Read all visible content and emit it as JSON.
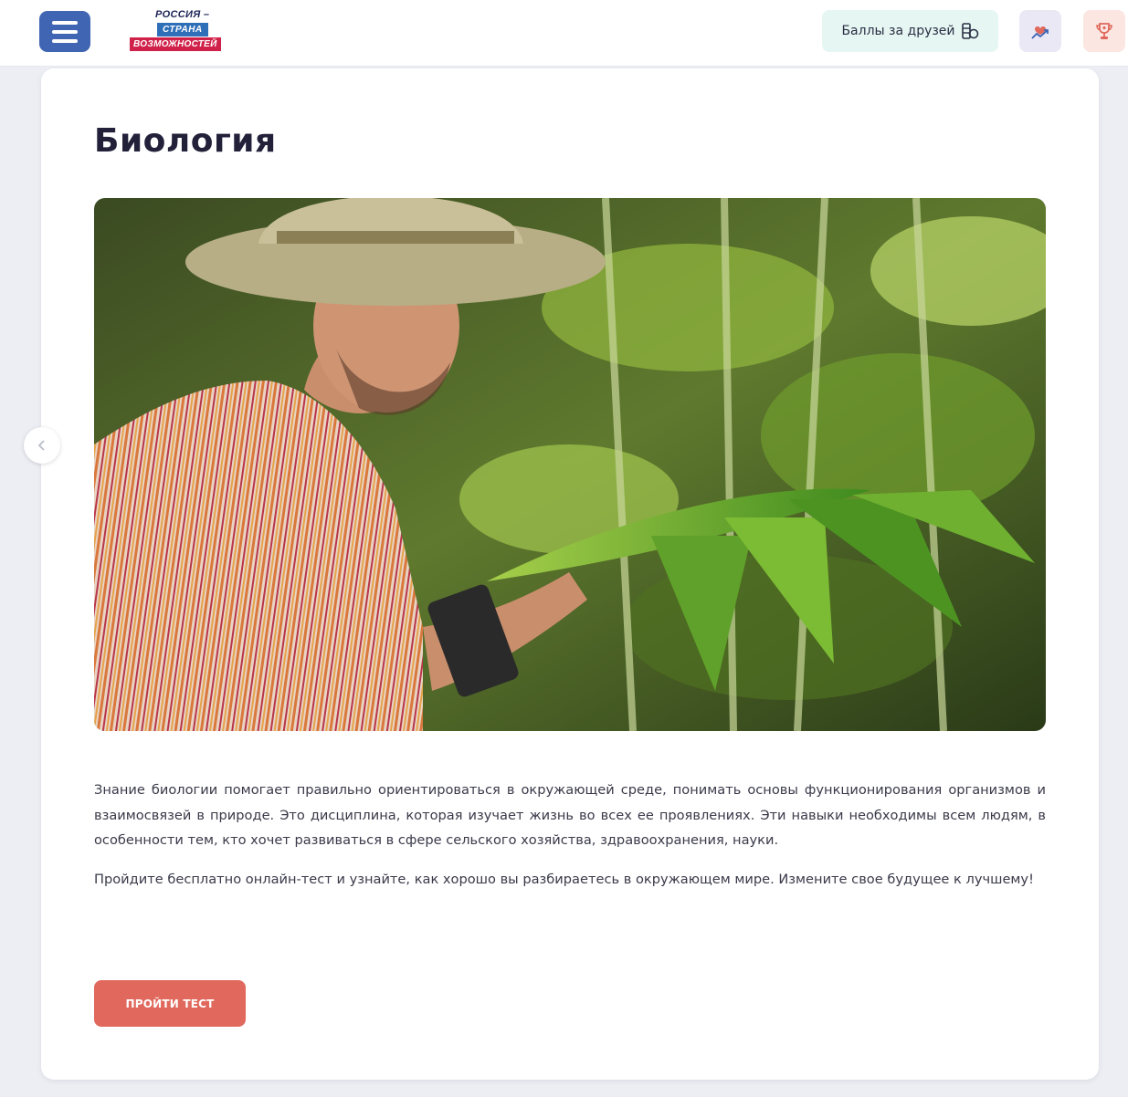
{
  "header": {
    "logo": {
      "line1": "РОССИЯ –",
      "line2": "СТРАНА",
      "line3": "ВОЗМОЖНОСТЕЙ"
    },
    "friends_points_label": "Баллы за друзей",
    "icons": {
      "menu": "menu-icon",
      "coins": "coins-icon",
      "likes": "heart-chart-icon",
      "trophy": "trophy-icon"
    },
    "colors": {
      "menu_bg": "#3f65b3",
      "friends_bg": "#e6f6f2",
      "likes_bg": "#ebe8f6",
      "trophy_bg": "#fbe6e1"
    }
  },
  "main": {
    "title": "Биология",
    "image_description": "",
    "paragraphs": [
      "Знание биологии помогает правильно ориентироваться в окружающей среде, понимать основы функционирования организмов и взаимосвязей в природе. Это дисциплина, которая изучает жизнь во всех ее проявлениях. Эти навыки необходимы всем людям, в особенности тем, кто хочет развиваться в сфере сельского хозяйства, здравоохранения, науки.",
      "Пройдите бесплатно онлайн-тест и узнайте, как хорошо вы разбираетесь в окружающем мире. Измените свое будущее к лучшему!"
    ],
    "cta_label": "ПРОЙТИ ТЕСТ",
    "carousel_prev_icon": "chevron-left-icon",
    "colors": {
      "cta": "#e0685c",
      "title": "#23213a"
    }
  }
}
